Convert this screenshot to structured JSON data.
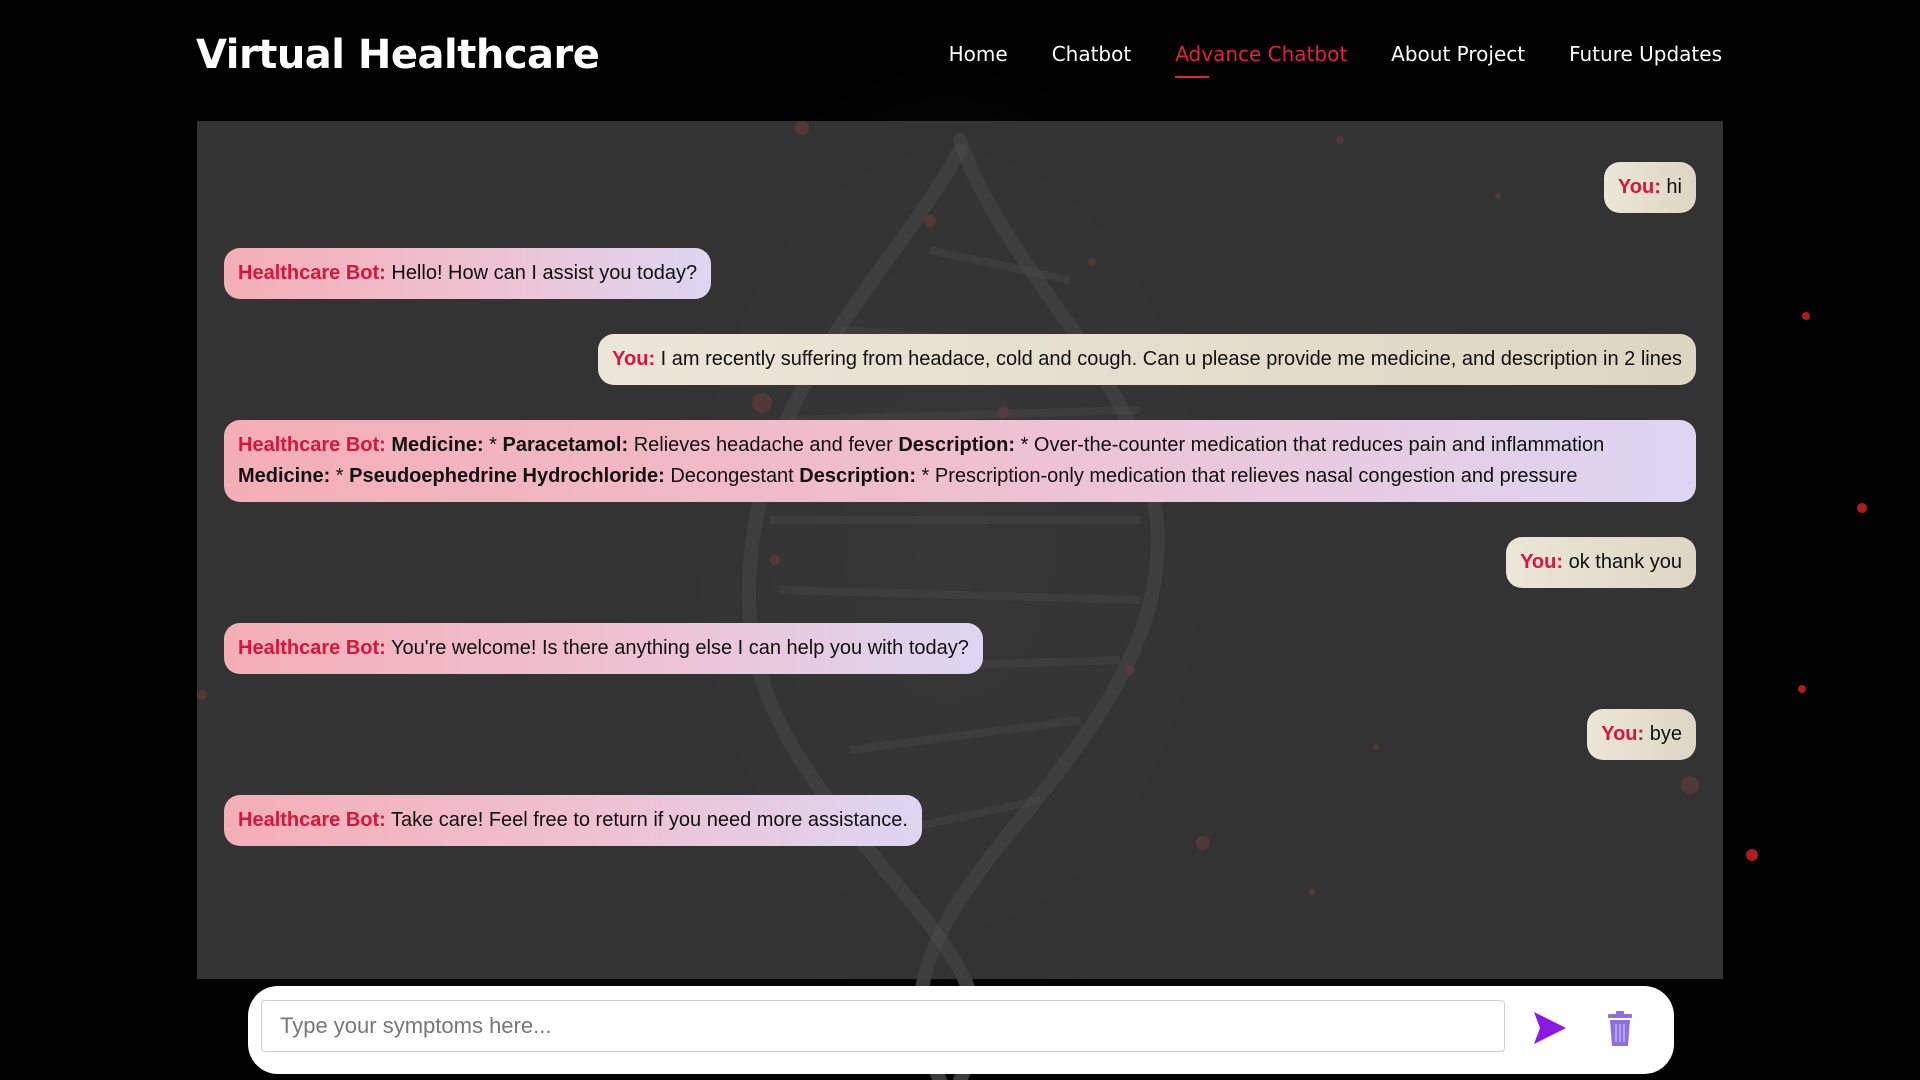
{
  "brand": "Virtual Healthcare",
  "nav": [
    {
      "label": "Home",
      "active": false
    },
    {
      "label": "Chatbot",
      "active": false
    },
    {
      "label": "Advance Chatbot",
      "active": true
    },
    {
      "label": "About Project",
      "active": false
    },
    {
      "label": "Future Updates",
      "active": false
    }
  ],
  "colors": {
    "accent": "#e0213f",
    "speaker": "#d6163c",
    "send_icon": "#8a18e6",
    "trash_icon": "#8c6fe0"
  },
  "messages": {
    "m1": {
      "speaker": "You:",
      "text": " hi"
    },
    "m2": {
      "speaker": "Healthcare Bot:",
      "text": " Hello! How can I assist you today?"
    },
    "m3": {
      "speaker": "You:",
      "text": " I am recently suffering from headace, cold and cough. Can u please provide me medicine, and description in 2 lines"
    },
    "m4": {
      "speaker": "Healthcare Bot:",
      "l1_label1": "Medicine:",
      "l1_t1": " * ",
      "l1_label2": "Paracetamol:",
      "l1_t2": " Relieves headache and fever ",
      "l1_label3": "Description:",
      "l1_t3": " * Over-the-counter medication that reduces pain and inflammation",
      "l2_label1": "Medicine:",
      "l2_t1": " * ",
      "l2_label2": "Pseudoephedrine Hydrochloride:",
      "l2_t2": " Decongestant ",
      "l2_label3": "Description:",
      "l2_t3": " * Prescription-only medication that relieves nasal congestion and pressure"
    },
    "m5": {
      "speaker": "You:",
      "text": " ok thank you"
    },
    "m6": {
      "speaker": "Healthcare Bot:",
      "text": " You're welcome! Is there anything else I can help you with today?"
    },
    "m7": {
      "speaker": "You:",
      "text": " bye"
    },
    "m8": {
      "speaker": "Healthcare Bot:",
      "text": " Take care! Feel free to return if you need more assistance."
    }
  },
  "input": {
    "placeholder": "Type your symptoms here...",
    "value": ""
  },
  "icons": {
    "send": "send-icon",
    "delete": "trash-icon"
  }
}
